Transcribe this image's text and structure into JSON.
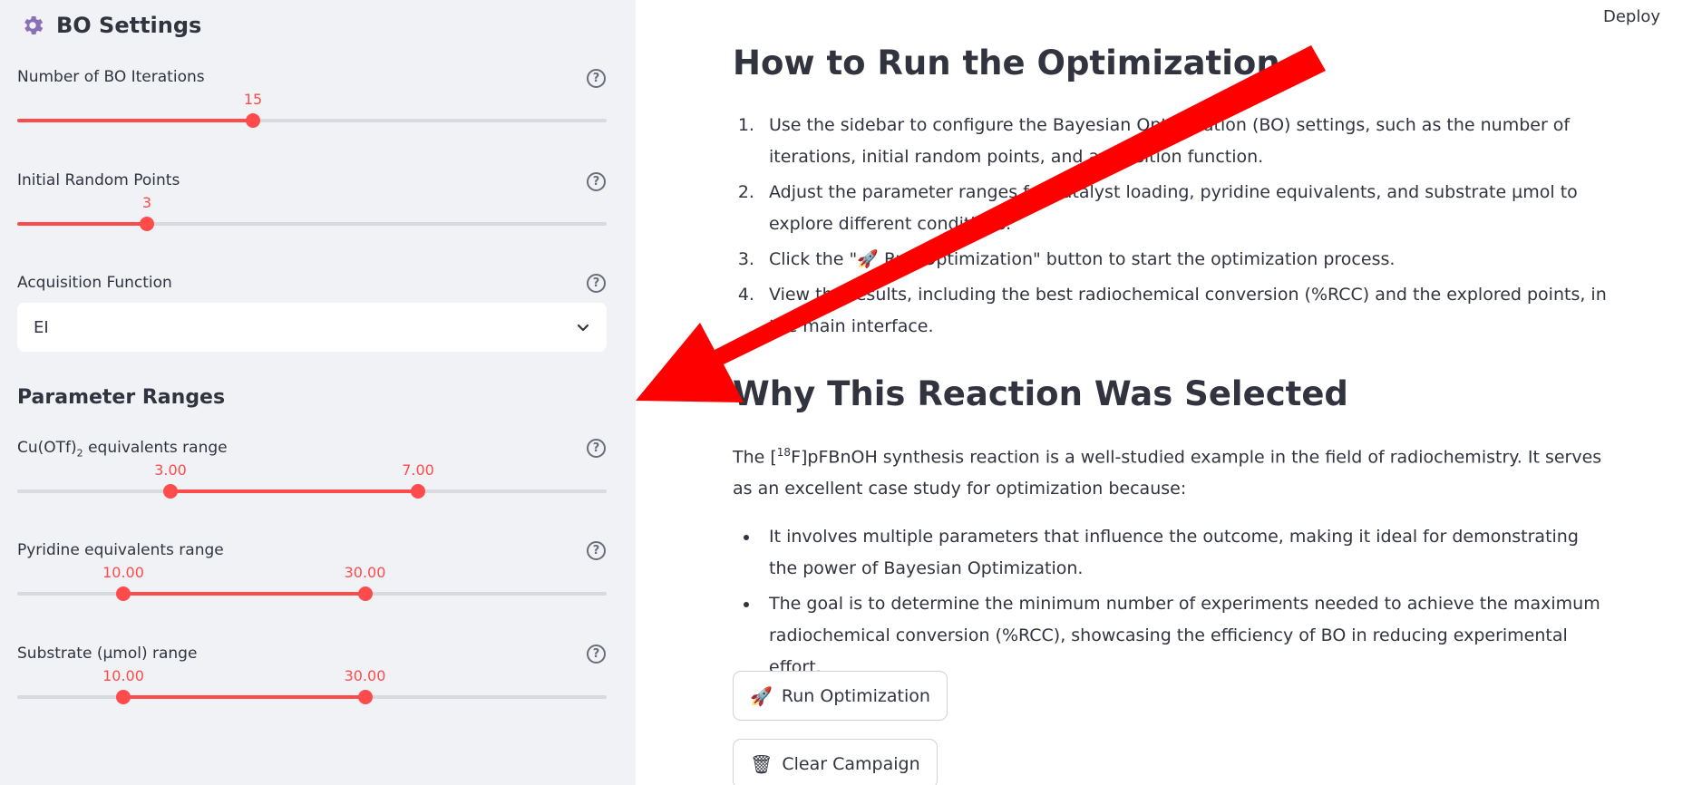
{
  "sidebar": {
    "title": "BO Settings",
    "iterations": {
      "label": "Number of BO Iterations",
      "value": "15",
      "fraction": 0.4
    },
    "random_points": {
      "label": "Initial Random Points",
      "value": "3",
      "fraction": 0.22
    },
    "acquisition": {
      "label": "Acquisition Function",
      "selected": "EI"
    },
    "param_header": "Parameter Ranges",
    "cu_range": {
      "label_pre": "Cu(OTf)",
      "label_sub": "2",
      "label_post": " equivalents range",
      "low": "3.00",
      "high": "7.00",
      "low_frac": 0.26,
      "high_frac": 0.68
    },
    "pyridine_range": {
      "label": "Pyridine equivalents range",
      "low": "10.00",
      "high": "30.00",
      "low_frac": 0.18,
      "high_frac": 0.59
    },
    "substrate_range": {
      "label": "Substrate (µmol) range",
      "low": "10.00",
      "high": "30.00",
      "low_frac": 0.18,
      "high_frac": 0.59
    }
  },
  "header": {
    "deploy": "Deploy"
  },
  "main": {
    "how_title": "How to Run the Optimization",
    "steps": [
      "Use the sidebar to configure the Bayesian Optimization (BO) settings, such as the number of iterations, initial random points, and acquisition function.",
      "Adjust the parameter ranges for catalyst loading, pyridine equivalents, and substrate µmol to explore different conditions.",
      "Click the \"🚀 Run Optimization\" button to start the optimization process.",
      "View the results, including the best radiochemical conversion (%RCC) and the explored points, in the main interface."
    ],
    "why_title": "Why This Reaction Was Selected",
    "why_pre": "The [",
    "why_sup": "18",
    "why_post": "F]pFBnOH synthesis reaction is a well-studied example in the field of radiochemistry. It serves as an excellent case study for optimization because:",
    "bullets": [
      "It involves multiple parameters that influence the outcome, making it ideal for demonstrating the power of Bayesian Optimization.",
      "The goal is to determine the minimum number of experiments needed to achieve the maximum radiochemical conversion (%RCC), showcasing the efficiency of BO in reducing experimental effort."
    ],
    "run_button": "Run Optimization",
    "run_icon": "🚀",
    "clear_button": "Clear Campaign",
    "clear_icon": "🗑"
  },
  "colors": {
    "accent": "#ff4b4b",
    "sidebar_bg": "#f0f2f6",
    "arrow": "#ff0000"
  }
}
